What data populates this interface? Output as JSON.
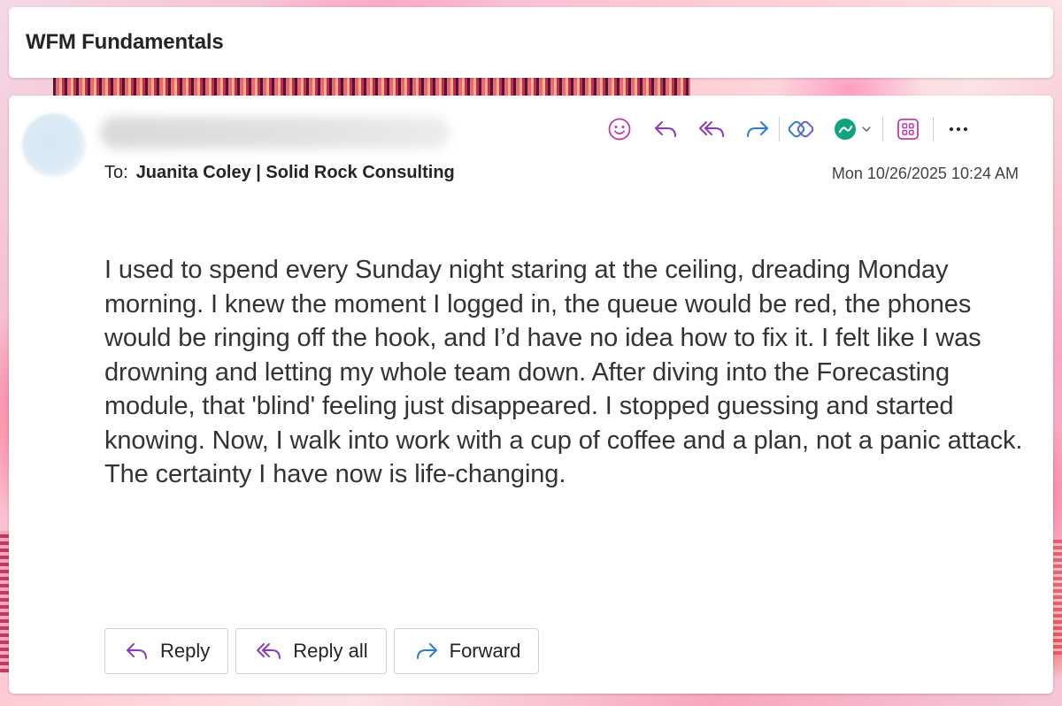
{
  "subject": {
    "title": "WFM Fundamentals"
  },
  "message": {
    "to_label": "To:",
    "to_value": "Juanita Coley | Solid Rock Consulting",
    "date": "Mon 10/26/2025 10:24 AM",
    "body": "I used to spend every Sunday night staring at the ceiling, dreading Monday morning. I knew the moment I logged in, the queue would be red, the phones would be ringing off the hook, and I’d have no idea how to fix it. I felt like I was drowning and letting my whole team down. After diving into the Forecasting module, that 'blind' feeling just disappeared. I stopped guessing and started knowing. Now, I walk into work with a cup of coffee and a plan, not a panic attack. The certainty I have now is life-changing."
  },
  "toolbar": {
    "icons": [
      "emoji-icon",
      "reply-icon",
      "reply-all-icon",
      "forward-icon",
      "copilot-icon",
      "app-icon",
      "chevron-down-icon",
      "apps-icon",
      "more-icon"
    ],
    "more_label": "···"
  },
  "actions": {
    "reply_label": "Reply",
    "reply_all_label": "Reply all",
    "forward_label": "Forward"
  },
  "colors": {
    "accent_pink": "#c239b3",
    "accent_purple": "#8a3ac2",
    "accent_blue": "#2b7bd6",
    "accent_green": "#10a37f"
  }
}
